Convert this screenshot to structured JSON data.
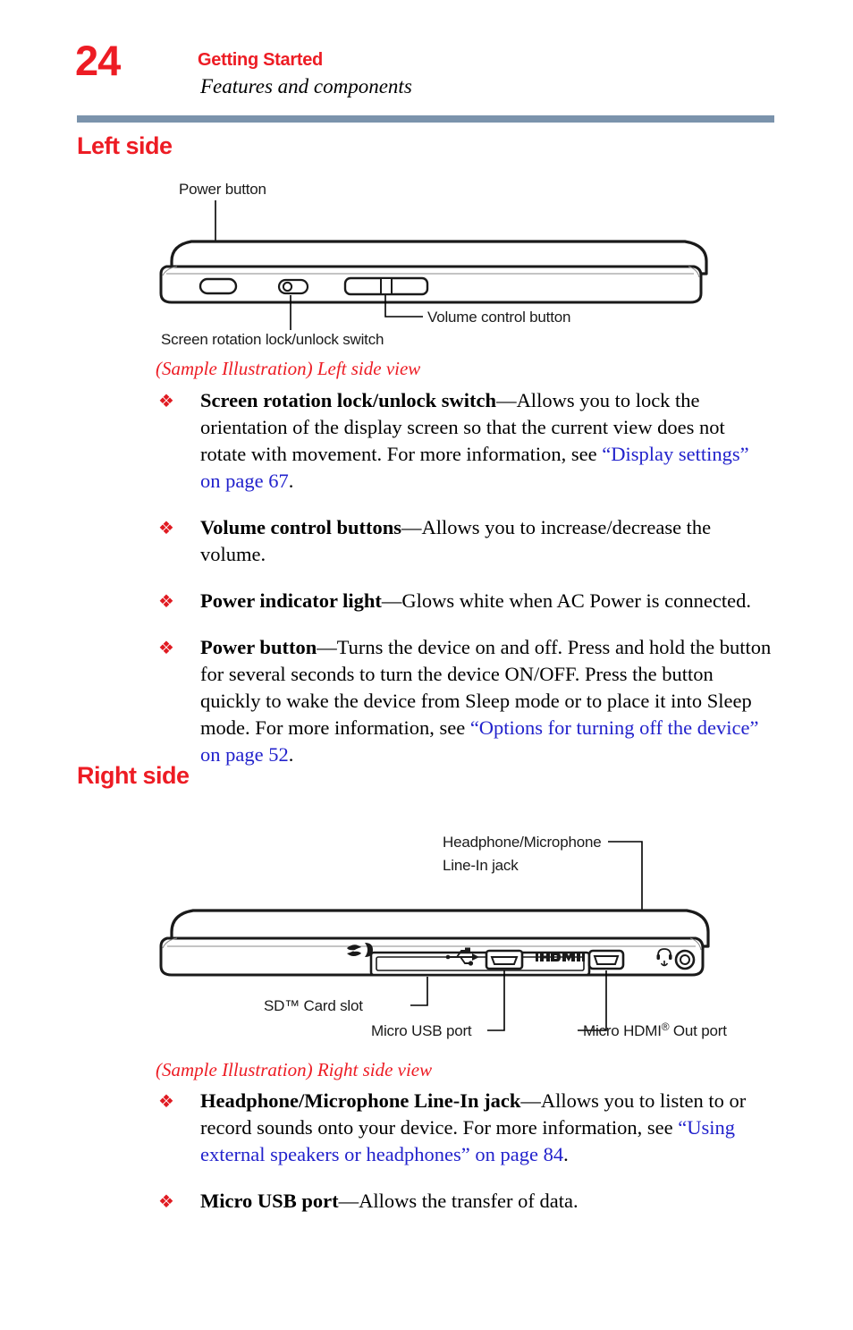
{
  "header": {
    "page_number": "24",
    "chapter": "Getting Started",
    "section": "Features and components",
    "rule_color": "#7b93ac",
    "accent_color": "#ed1c24"
  },
  "sections": [
    {
      "heading": "Left side",
      "figure": {
        "caption": "(Sample Illustration) Left side view",
        "callouts": [
          {
            "name": "power-button",
            "label": "Power button"
          },
          {
            "name": "screen-rotation-switch",
            "label": "Screen rotation lock/unlock switch"
          },
          {
            "name": "volume-control-button",
            "label": "Volume control button"
          }
        ]
      },
      "bullets": [
        {
          "term": "Screen rotation lock/unlock switch",
          "dash": "—",
          "body_before": "Allows you to lock the orientation of the display screen so that the current view does not rotate with movement. For more information, see ",
          "xref": "“Display settings” on page 67",
          "body_after": "."
        },
        {
          "term": "Volume control buttons",
          "dash": "—",
          "body_before": "Allows you to increase/decrease the volume.",
          "xref": "",
          "body_after": ""
        },
        {
          "term": "Power indicator light",
          "dash": "—",
          "body_before": "Glows white when AC Power is connected.",
          "xref": "",
          "body_after": ""
        },
        {
          "term": "Power button",
          "dash": "—",
          "body_before": "Turns the device on and off. Press and hold the button for several seconds to turn the device ON/OFF. Press the button quickly to wake the device from Sleep mode or to place it into Sleep mode. For more information, see ",
          "xref": "“Options for turning off the device” on page 52",
          "body_after": "."
        }
      ]
    },
    {
      "heading": "Right side",
      "figure": {
        "caption": "(Sample Illustration) Right side view",
        "callouts": [
          {
            "name": "headphone-mic-jack",
            "label_line1": "Headphone/Microphone",
            "label_line2": "Line-In jack"
          },
          {
            "name": "sd-card-slot",
            "label": "SD™ Card slot"
          },
          {
            "name": "micro-usb-port",
            "label": "Micro USB port"
          },
          {
            "name": "micro-hdmi-port",
            "label_main": "Micro HDMI",
            "label_sup": "®",
            "label_tail": " Out port"
          }
        ],
        "port_icons": [
          {
            "name": "sd-logo-icon",
            "glyph": "SD"
          },
          {
            "name": "usb-icon",
            "glyph": "USB"
          },
          {
            "name": "hdmi-logo-icon",
            "glyph": "HDMI"
          },
          {
            "name": "headphone-mic-icon",
            "glyph": "headset"
          }
        ]
      },
      "bullets": [
        {
          "term": "Headphone/Microphone Line-In jack",
          "dash": "—",
          "body_before": "Allows you to listen to or record sounds onto your device. For more information, see ",
          "xref": "“Using external speakers or headphones” on page 84",
          "body_after": "."
        },
        {
          "term": "Micro USB port",
          "dash": "—",
          "body_before": "Allows the transfer of data.",
          "xref": "",
          "body_after": ""
        }
      ]
    }
  ],
  "bullet_marker": "❖"
}
